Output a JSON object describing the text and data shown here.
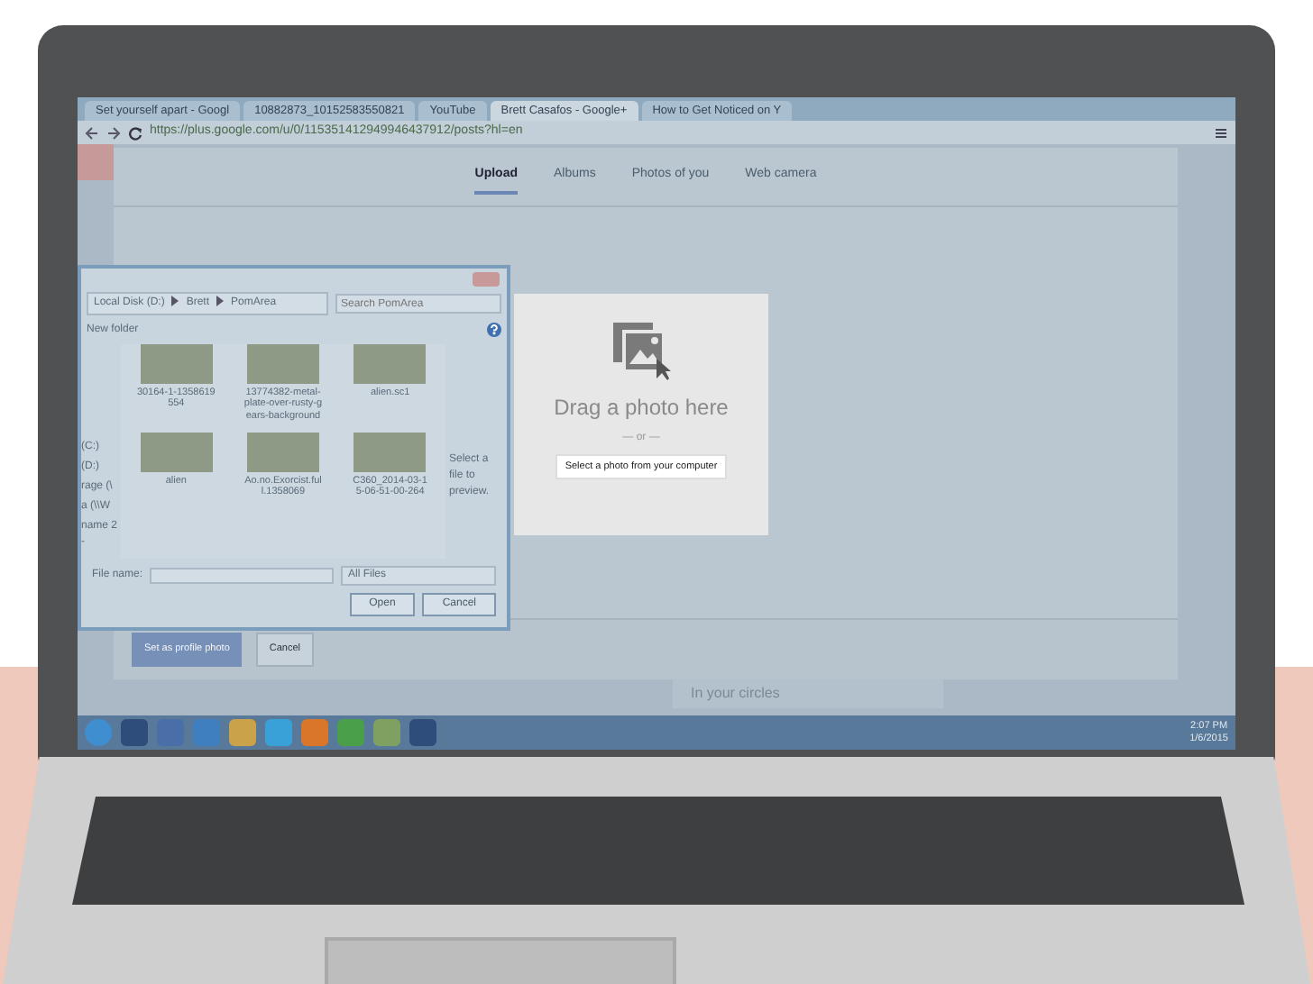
{
  "browser": {
    "tabs": [
      {
        "label": "Set yourself apart - Googl",
        "selected": false
      },
      {
        "label": "10882873_10152583550821",
        "selected": false
      },
      {
        "label": "YouTube",
        "selected": false
      },
      {
        "label": "Brett Casafos - Google+",
        "selected": true
      },
      {
        "label": "How to Get Noticed on Y",
        "selected": false
      }
    ],
    "url": "https://plus.google.com/u/0/115351412949946437912/posts?hl=en"
  },
  "photo_dialog": {
    "tabs": [
      {
        "label": "Upload",
        "selected": true
      },
      {
        "label": "Albums",
        "selected": false
      },
      {
        "label": "Photos of you",
        "selected": false
      },
      {
        "label": "Web camera",
        "selected": false
      }
    ],
    "drop_title": "Drag a photo here",
    "or_text": "— or —",
    "select_button": "Select a photo from your computer",
    "buttons": [
      {
        "label": "Set as profile photo",
        "disabled": true
      },
      {
        "label": "Cancel",
        "disabled": false
      }
    ]
  },
  "background_text": "In your circles",
  "file_dialog": {
    "breadcrumb": [
      "Local Disk (D:)",
      "Brett",
      "PomArea"
    ],
    "search_placeholder": "Search PomArea",
    "new_folder": "New folder",
    "sidebar_items": [
      "(C:)",
      "(D:)",
      "rage (\\",
      "a (\\\\W",
      "name 2 -"
    ],
    "files": [
      {
        "name": "30164-1-1358619554"
      },
      {
        "name": "13774382-metal-plate-over-rusty-gears-background"
      },
      {
        "name": "alien.sc1"
      },
      {
        "name": "alien"
      },
      {
        "name": "Ao.no.Exorcist.full.1358069"
      },
      {
        "name": "C360_2014-03-15-06-51-00-264"
      }
    ],
    "preview_text": "Select a file to preview.",
    "file_name_label": "File name:",
    "filter": "All Files",
    "open_button": "Open",
    "cancel_button": "Cancel"
  },
  "taskbar": {
    "time": "2:07 PM",
    "date": "1/6/2015"
  }
}
